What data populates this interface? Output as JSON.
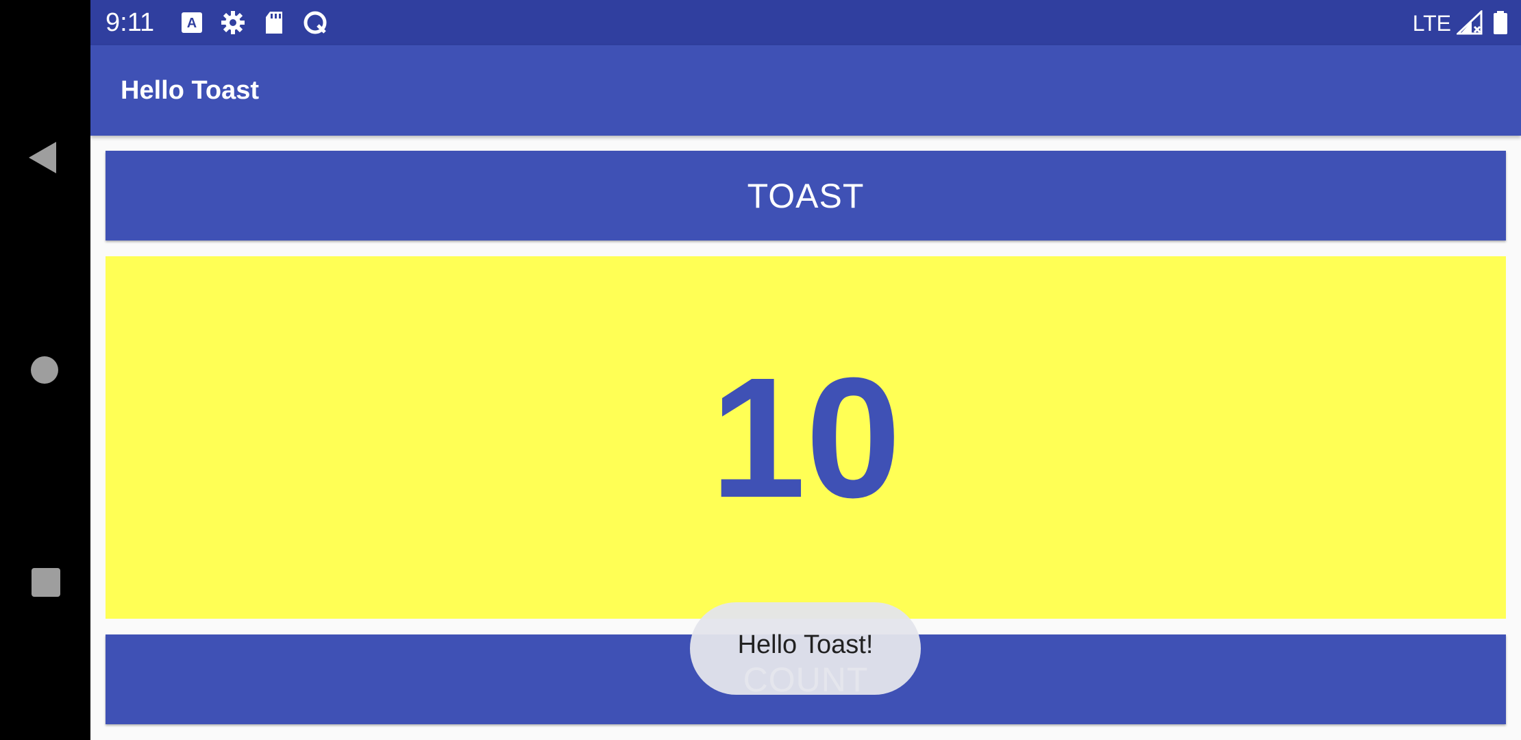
{
  "status_bar": {
    "time": "9:11",
    "network": "LTE",
    "icons": [
      "text-recognition-icon",
      "gear-icon",
      "sd-card-icon",
      "data-saver-icon",
      "signal-icon",
      "battery-icon"
    ]
  },
  "app_bar": {
    "title": "Hello Toast"
  },
  "main": {
    "toast_button_label": "TOAST",
    "count_value": "10",
    "count_button_label": "COUNT"
  },
  "toast": {
    "message": "Hello Toast!"
  },
  "nav_bar": {
    "icons": [
      "back-icon",
      "home-icon",
      "recents-icon"
    ]
  },
  "colors": {
    "primary": "#3f51b5",
    "primary_dark": "#303f9f",
    "count_background": "#ffff55",
    "nav_background": "#000000"
  }
}
